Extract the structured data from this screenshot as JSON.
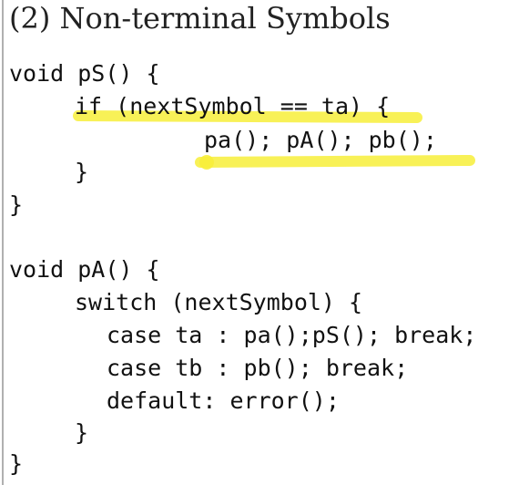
{
  "title": "(2) Non-terminal Symbols",
  "highlight_color": "#f7ee3a",
  "code": {
    "pS_signature": "void pS() {",
    "pS_if": "if (nextSymbol == ta) {",
    "pS_calls": "pa(); pA(); pb();",
    "pS_if_close": "}",
    "pS_close": "}",
    "pA_signature": "void pA() {",
    "pA_switch": "switch (nextSymbol) {",
    "pA_case_ta": "case ta : pa();pS(); break;",
    "pA_case_tb": "case tb : pb(); break;",
    "pA_default": "default: error();",
    "pA_switch_close": "}",
    "pA_close": "}"
  }
}
